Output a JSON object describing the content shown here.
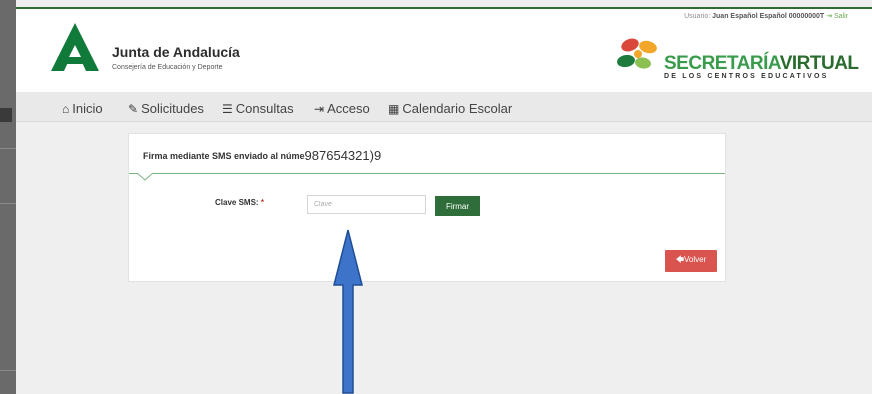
{
  "user_bar": {
    "label": "Usuario:",
    "user": "Juan Español Español 00000000T",
    "logout": "Salir"
  },
  "header": {
    "org_title": "Junta de Andalucía",
    "org_subtitle": "Consejería de Educación y Deporte",
    "sv_title_1": "SECRETARÍA",
    "sv_title_2": "VIRTUAL",
    "sv_subtitle": "DE LOS CENTROS EDUCATIVOS"
  },
  "nav": {
    "items": [
      {
        "label": "Inicio",
        "icon": "home-icon"
      },
      {
        "label": "Solicitudes",
        "icon": "pencil-icon"
      },
      {
        "label": "Consultas",
        "icon": "list-icon"
      },
      {
        "label": "Acceso",
        "icon": "sign-in-icon"
      },
      {
        "label": "Calendario Escolar",
        "icon": "calendar-icon"
      }
    ]
  },
  "panel": {
    "title": "Firma mediante SMS enviado al núme",
    "phone": "987654321)9",
    "clave_label": "Clave SMS:",
    "required_mark": "*",
    "clave_placeholder": "Clave",
    "clave_value": "",
    "firmar_label": "Firmar",
    "volver_label": "Volver"
  },
  "colors": {
    "primary_green": "#2f6e3a",
    "danger_red": "#d9534f",
    "arrow_blue": "#3d74c9"
  }
}
